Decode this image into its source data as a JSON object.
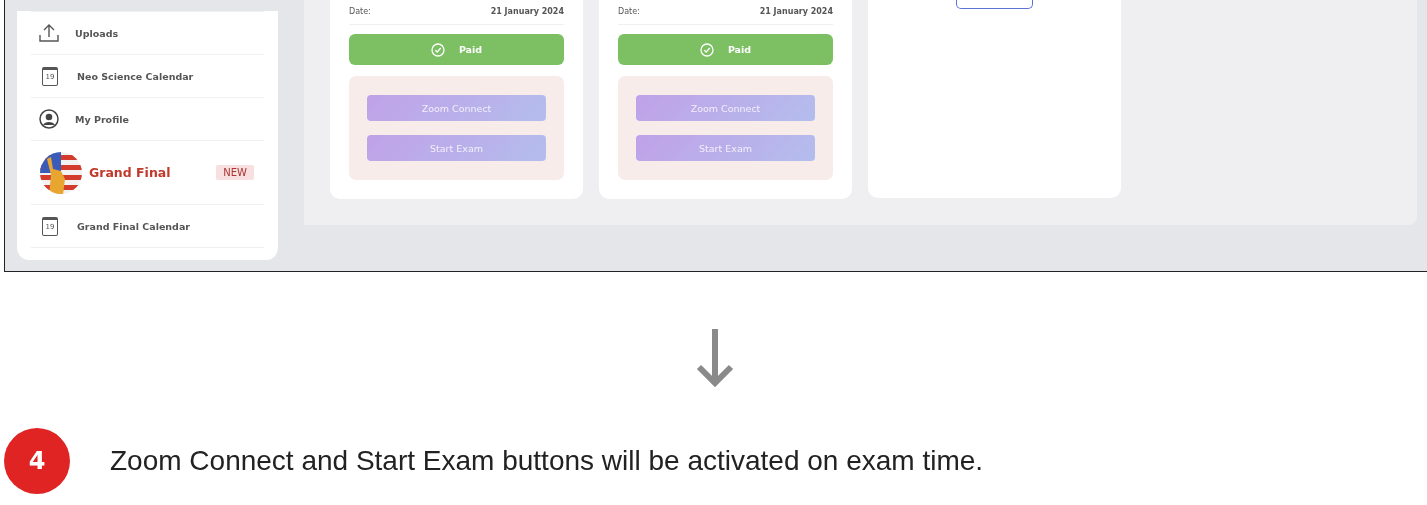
{
  "sidebar": {
    "items": [
      {
        "kind": "nav",
        "label": "Uploads"
      },
      {
        "kind": "nav",
        "label": "Neo Science Calendar",
        "calendar_day": "19"
      },
      {
        "kind": "nav",
        "label": "My Profile"
      },
      {
        "kind": "featured",
        "label": "Grand Final",
        "badge": "NEW"
      },
      {
        "kind": "nav",
        "label": "Grand Final Calendar",
        "calendar_day": "19"
      }
    ]
  },
  "exam_cards": [
    {
      "date_label": "Date:",
      "date": "21 January 2024",
      "payment_status": "Paid",
      "actions": [
        {
          "label": "Zoom Connect",
          "disabled": true
        },
        {
          "label": "Start Exam",
          "disabled": true
        }
      ]
    },
    {
      "date_label": "Date:",
      "date": "21 January 2024",
      "payment_status": "Paid",
      "actions": [
        {
          "label": "Zoom Connect",
          "disabled": true
        },
        {
          "label": "Start Exam",
          "disabled": true
        }
      ]
    }
  ],
  "add_card": {
    "has_button": true
  },
  "step": {
    "number": "4",
    "text": "Zoom Connect and Start Exam buttons will be activated on exam time."
  }
}
